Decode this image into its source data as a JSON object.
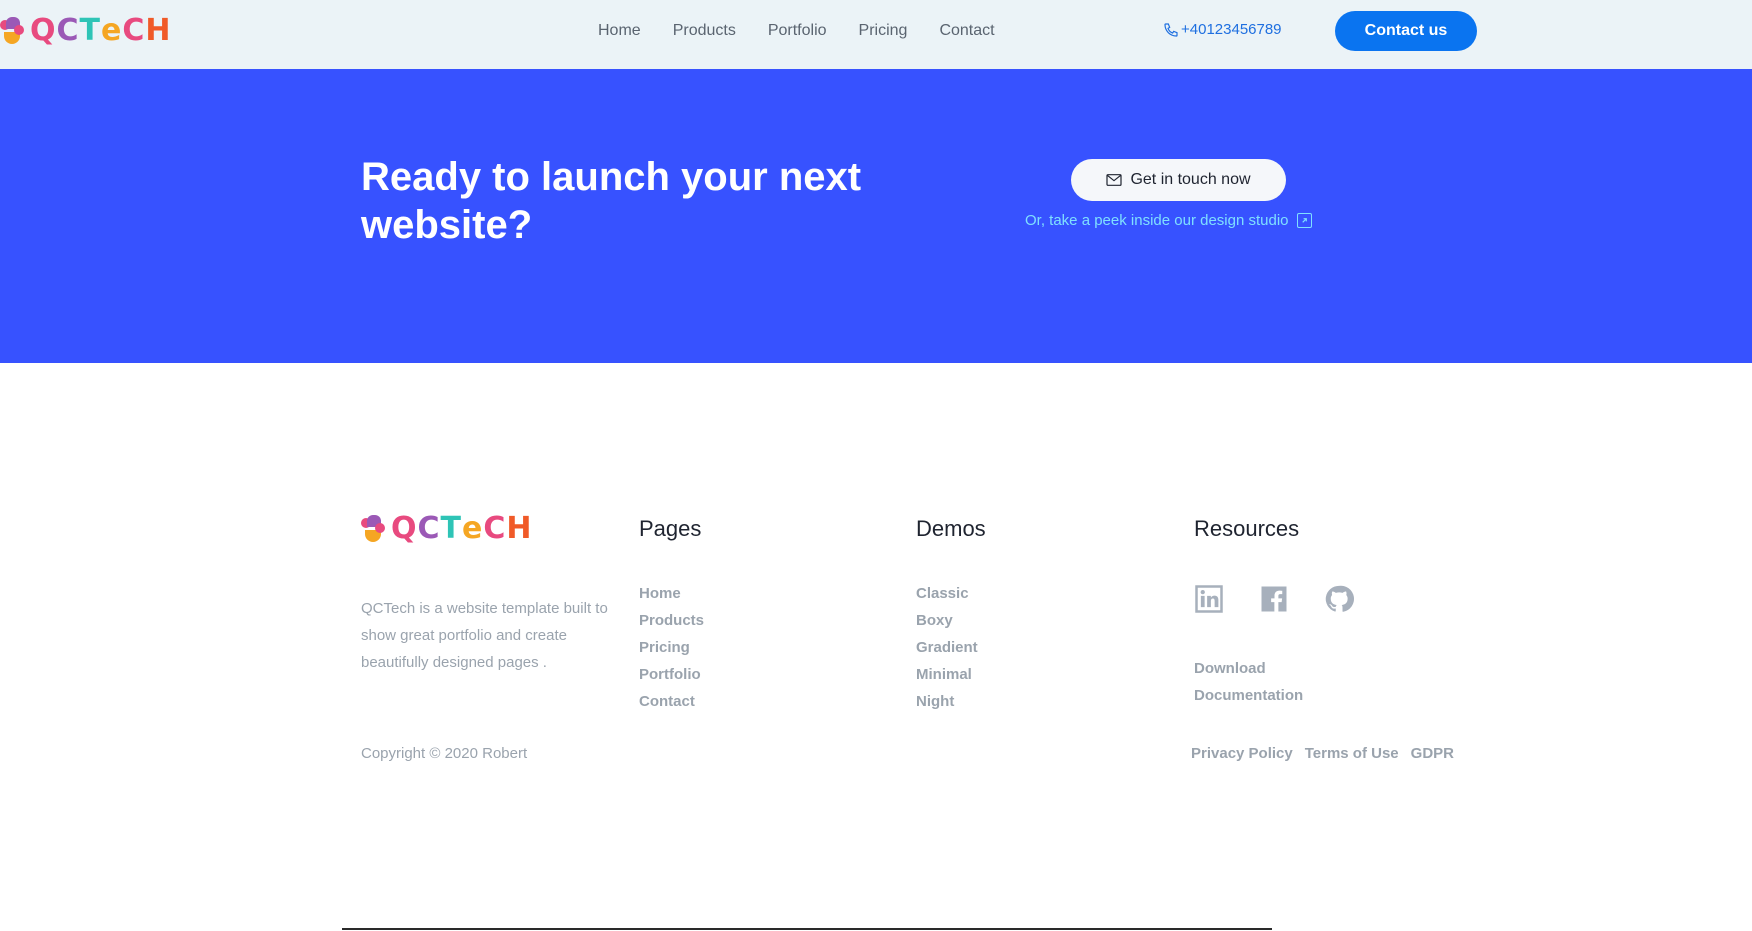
{
  "nav": {
    "logo": {
      "letters": [
        "Q",
        "C",
        "T",
        "e",
        "C",
        "H"
      ],
      "colors": [
        "#e84a7f",
        "#9b59b6",
        "#2ec4b6",
        "#f5a623",
        "#e84a7f",
        "#f05a28"
      ]
    },
    "links": [
      "Home",
      "Products",
      "Portfolio",
      "Pricing",
      "Contact"
    ],
    "phone": "+40123456789",
    "contact_button": "Contact us"
  },
  "cta": {
    "title": "Ready to launch your next website?",
    "button": "Get in touch now",
    "studio_link": "Or, take a peek inside our design studio"
  },
  "footer": {
    "description": "QCTech is a website template built to show great portfolio and create beautifully designed pages .",
    "copyright": "Copyright © 2020 Robert",
    "pages": {
      "title": "Pages",
      "items": [
        "Home",
        "Products",
        "Pricing",
        "Portfolio",
        "Contact"
      ]
    },
    "demos": {
      "title": "Demos",
      "items": [
        "Classic",
        "Boxy",
        "Gradient",
        "Minimal",
        "Night"
      ]
    },
    "resources": {
      "title": "Resources",
      "socials": [
        "linkedin-icon",
        "facebook-icon",
        "github-icon"
      ],
      "links": [
        "Download",
        "Documentation"
      ]
    },
    "legal": [
      "Privacy Policy",
      "Terms of Use",
      "GDPR"
    ]
  },
  "colors": {
    "nav_bg": "#ebf3f7",
    "cta_bg": "#3752ff",
    "primary": "#0a74f0",
    "studio_link": "#7fe0ff",
    "muted": "#9aa3ad"
  }
}
